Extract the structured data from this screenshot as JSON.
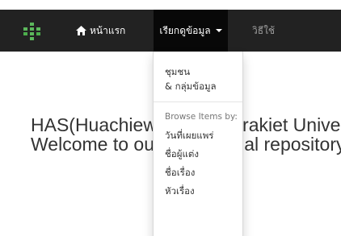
{
  "navbar": {
    "home_label": "หน้าแรก",
    "browse_label": "เรียกดูข้อมูล",
    "help_label": "วิธีใช้",
    "background": "#222222",
    "active_background": "#080808",
    "logo_color": "#5cb85c"
  },
  "main": {
    "line1": "HAS(Huachiew Chalermprakiet University Academic Repository System)",
    "line2": "Welcome to our institutional repository"
  },
  "dropdown": {
    "communities_line1": "ชุมชน",
    "communities_line2": "& กลุ่มข้อมูล",
    "browse_header": "Browse Items by:",
    "items": [
      "วันที่เผยแพร่",
      "ชื่อผู้แต่ง",
      "ชื่อเรื่อง",
      "หัวเรื่อง"
    ]
  }
}
